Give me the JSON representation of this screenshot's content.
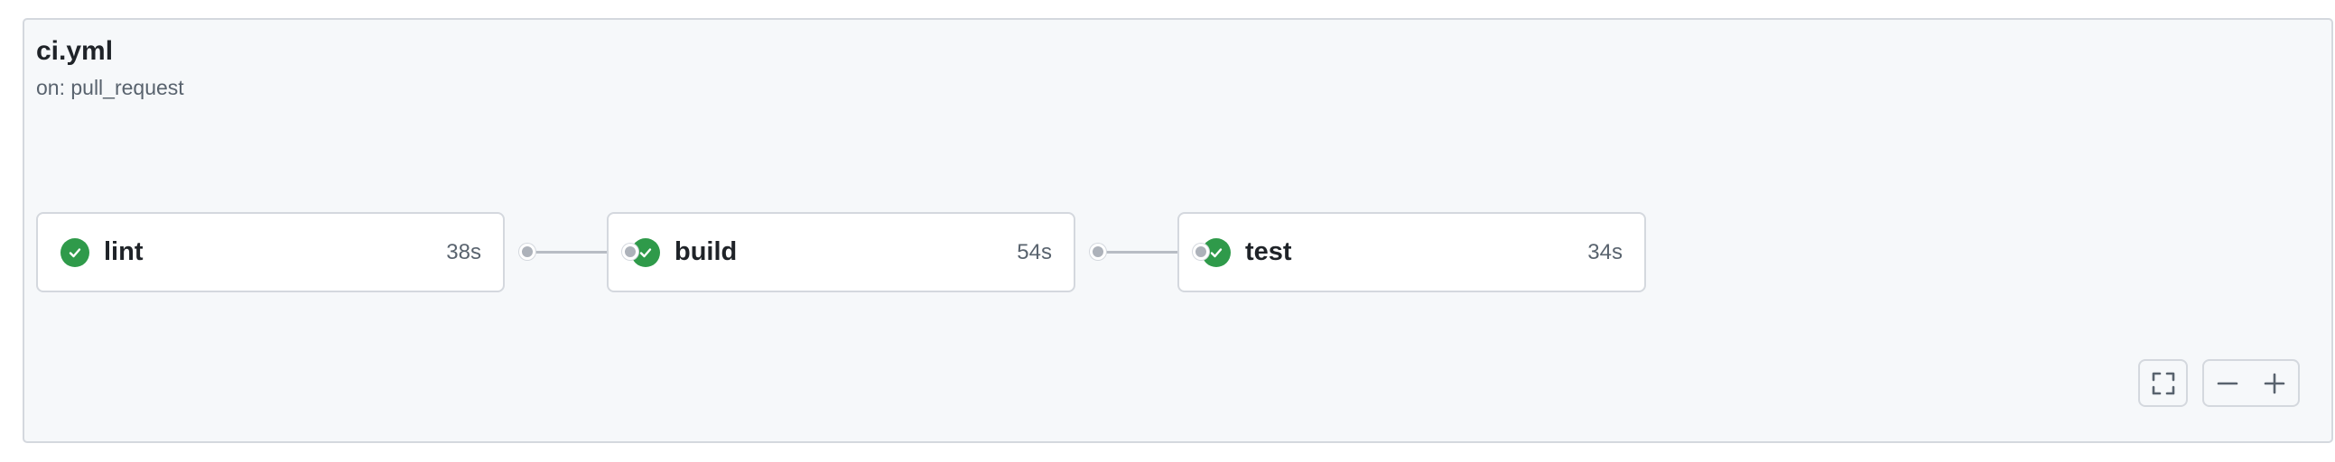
{
  "workflow": {
    "file_name": "ci.yml",
    "trigger": "on: pull_request"
  },
  "jobs": [
    {
      "name": "lint",
      "duration": "38s",
      "status": "success",
      "status_icon": "check-circle-icon"
    },
    {
      "name": "build",
      "duration": "54s",
      "status": "success",
      "status_icon": "check-circle-icon"
    },
    {
      "name": "test",
      "duration": "34s",
      "status": "success",
      "status_icon": "check-circle-icon"
    }
  ],
  "controls": {
    "fullscreen_icon": "fullscreen-icon",
    "zoom_out_icon": "minus-icon",
    "zoom_in_icon": "plus-icon"
  },
  "colors": {
    "success": "#2f9a4a",
    "panel_background": "#f6f8fa",
    "border": "#d4d8de",
    "connector": "#b7bcc4"
  }
}
